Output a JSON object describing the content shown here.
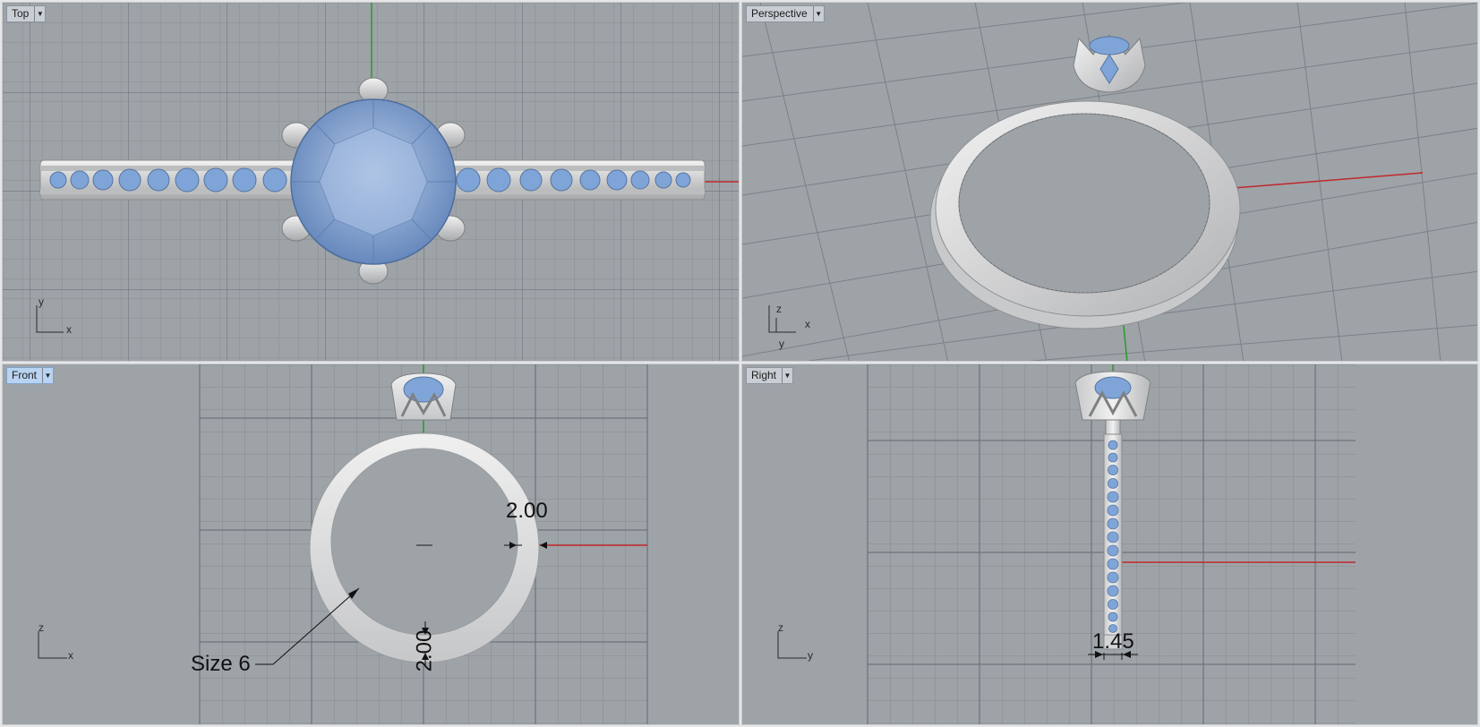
{
  "viewports": {
    "top": {
      "label": "Top",
      "axis_v": "y",
      "axis_h": "x"
    },
    "perspective": {
      "label": "Perspective",
      "axis_v": "z",
      "axis_h": "x",
      "axis_d": "y"
    },
    "front": {
      "label": "Front",
      "axis_v": "z",
      "axis_h": "x"
    },
    "right": {
      "label": "Right",
      "axis_v": "z",
      "axis_h": "y"
    }
  },
  "annotations": {
    "front_band_width": "2.00",
    "front_band_bottom": "2.00",
    "ring_size": "Size 6",
    "right_band_thickness": "1.45"
  },
  "colors": {
    "viewport_bg": "#9ea3a8",
    "grid": "#878c92",
    "grid_major": "#6f747a",
    "x_axis": "#c0282a",
    "y_axis": "#2a9a2a",
    "z_axis": "#2a3ad0",
    "metal": "#d9dadb",
    "gem": "#7fa5d8",
    "active_tab": "#b9d3f0"
  },
  "icons": {
    "dropdown": "triangle-down-icon"
  }
}
